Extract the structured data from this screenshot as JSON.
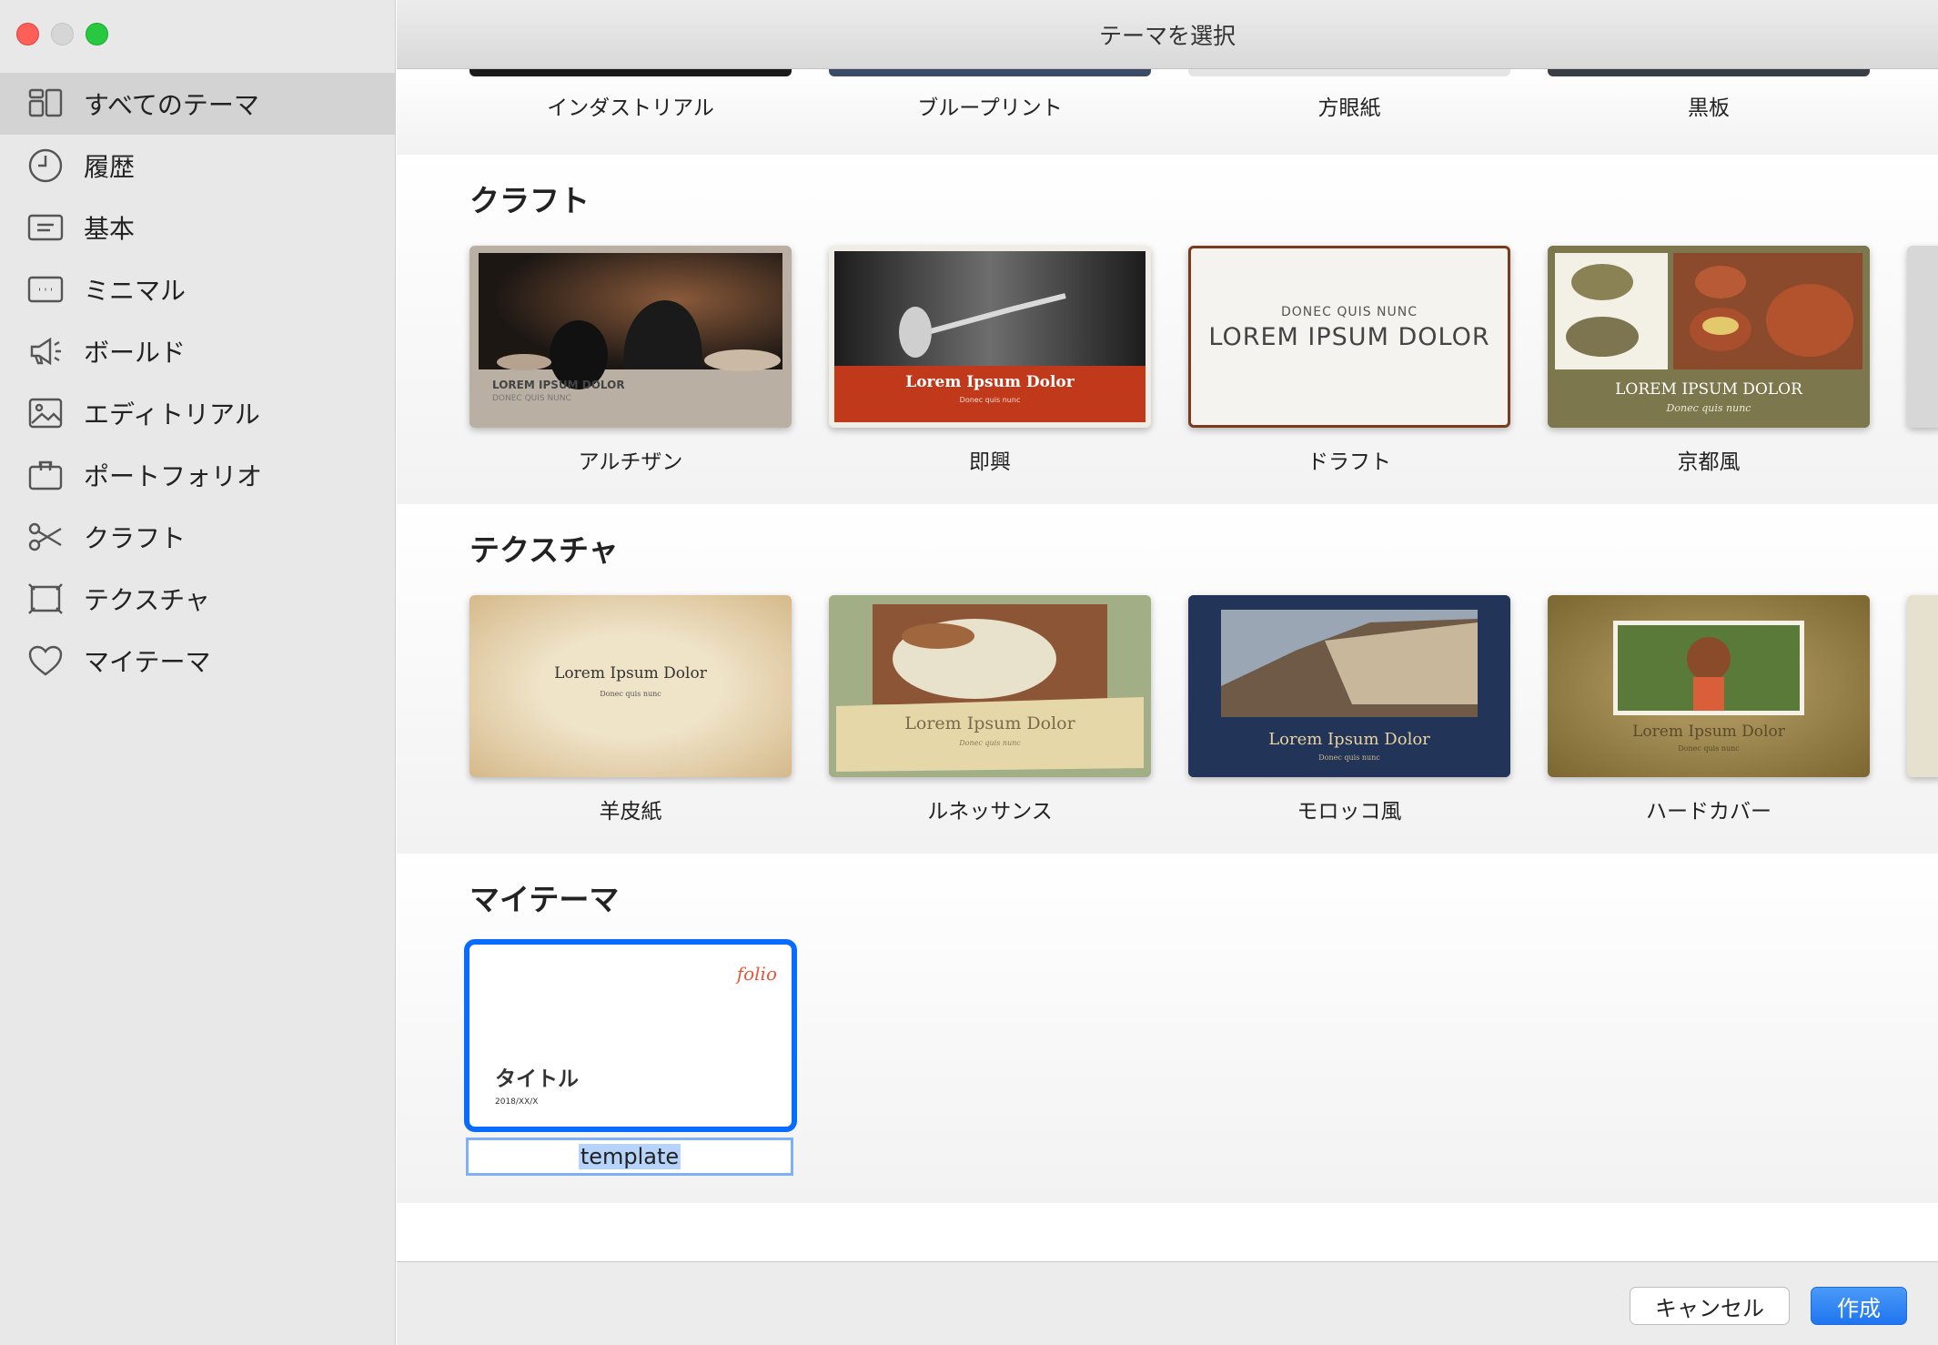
{
  "window": {
    "title": "テーマを選択"
  },
  "sidebar": {
    "items": [
      {
        "label": "すべてのテーマ",
        "icon": "grid-icon"
      },
      {
        "label": "履歴",
        "icon": "clock-icon"
      },
      {
        "label": "基本",
        "icon": "basic-slide-icon"
      },
      {
        "label": "ミニマル",
        "icon": "minimal-slide-icon"
      },
      {
        "label": "ボールド",
        "icon": "megaphone-icon"
      },
      {
        "label": "エディトリアル",
        "icon": "image-icon"
      },
      {
        "label": "ポートフォリオ",
        "icon": "briefcase-icon"
      },
      {
        "label": "クラフト",
        "icon": "scissors-icon"
      },
      {
        "label": "テクスチャ",
        "icon": "frame-icon"
      },
      {
        "label": "マイテーマ",
        "icon": "heart-icon"
      }
    ]
  },
  "top_row": {
    "labels": [
      "インダストリアル",
      "ブループリント",
      "方眼紙",
      "黒板"
    ]
  },
  "craft": {
    "title": "クラフト",
    "themes": [
      {
        "label": "アルチザン",
        "line1": "LOREM IPSUM DOLOR",
        "line2": "DONEC QUIS NUNC"
      },
      {
        "label": "即興",
        "line1": "Lorem Ipsum Dolor",
        "line2": "Donec quis nunc"
      },
      {
        "label": "ドラフト",
        "line1": "DONEC QUIS NUNC",
        "line2": "LOREM IPSUM DOLOR"
      },
      {
        "label": "京都風",
        "line1": "LOREM IPSUM DOLOR",
        "line2": "Donec quis nunc"
      }
    ]
  },
  "texture": {
    "title": "テクスチャ",
    "themes": [
      {
        "label": "羊皮紙",
        "line1": "Lorem Ipsum Dolor",
        "line2": "Donec quis nunc"
      },
      {
        "label": "ルネッサンス",
        "line1": "Lorem Ipsum Dolor",
        "line2": "Donec quis nunc"
      },
      {
        "label": "モロッコ風",
        "line1": "Lorem Ipsum Dolor",
        "line2": "Donec quis nunc"
      },
      {
        "label": "ハードカバー",
        "line1": "Lorem Ipsum Dolor",
        "line2": "Donec quis nunc"
      }
    ]
  },
  "my_themes": {
    "title": "マイテーマ",
    "template": {
      "logo": "folio",
      "slide_title": "タイトル",
      "date": "2018/XX/X",
      "name": "template"
    }
  },
  "buttons": {
    "cancel": "キャンセル",
    "create": "作成"
  },
  "colors": {
    "accent": "#1f75f0",
    "selection": "#0a6cff",
    "sidebar_bg": "#e8e8e8"
  }
}
